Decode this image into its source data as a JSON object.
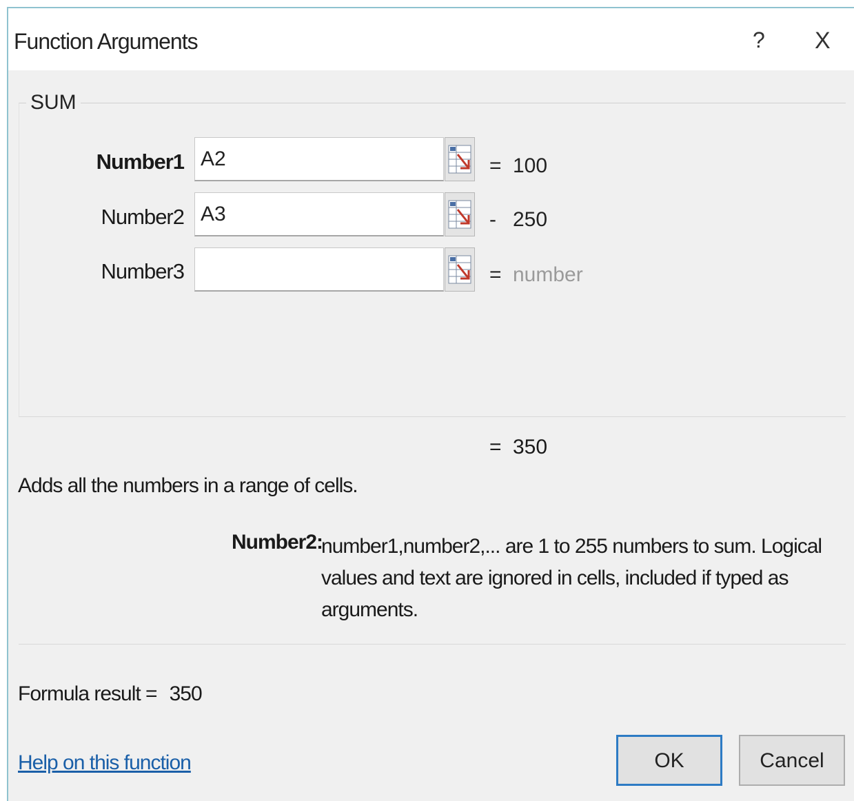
{
  "window": {
    "title": "Function Arguments",
    "help_glyph": "?",
    "close_glyph": "X"
  },
  "function": {
    "name": "SUM",
    "arguments": [
      {
        "label": "Number1",
        "value": "A2",
        "eq": "=",
        "result": "100",
        "active": true
      },
      {
        "label": "Number2",
        "value": "A3",
        "eq": "-",
        "result": "250",
        "active": false
      },
      {
        "label": "Number3",
        "value": "",
        "eq": "=",
        "result": "number",
        "active": false
      }
    ],
    "ref_icon": "collapse-dialog-icon",
    "result_eq": "=",
    "result_value": "350",
    "description": "Adds all the numbers in a range of cells.",
    "arg_help_name": "Number2:",
    "arg_help_text": "number1,number2,... are 1 to 255 numbers to sum. Logical values and text are ignored in cells, included if typed as arguments."
  },
  "footer": {
    "formula_result_label": "Formula result =",
    "formula_result_value": "350",
    "help_link": "Help on this function",
    "ok_label": "OK",
    "cancel_label": "Cancel"
  },
  "colors": {
    "accent": "#2d7bc4",
    "link": "#1a5fa8",
    "dialog_bg": "#f0f0f0"
  }
}
